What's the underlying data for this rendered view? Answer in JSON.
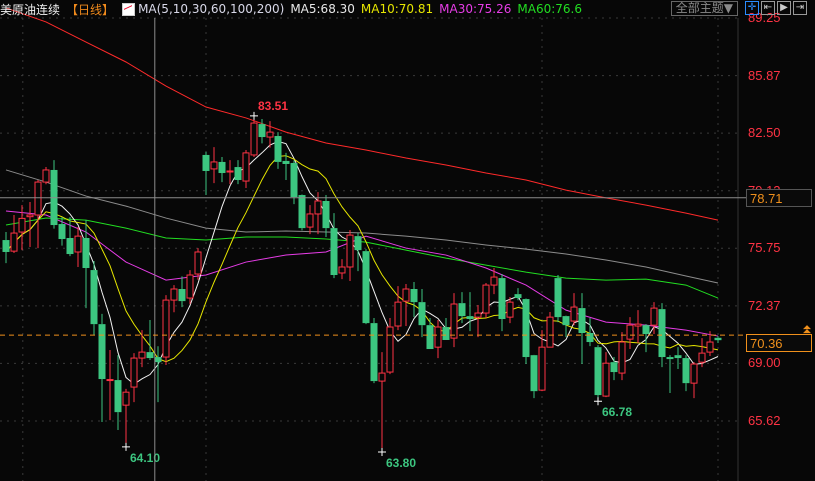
{
  "header": {
    "symbol": "美原油连续",
    "period_open": "【",
    "period": "日线",
    "period_close": "】",
    "ma_title": "MA(5,10,30,60,100,200)",
    "ma5": "MA5:68.30",
    "ma10": "MA10:70.81",
    "ma30": "MA30:75.26",
    "ma60": "MA60:76.6"
  },
  "toolbar": {
    "theme_label": "全部主题▼",
    "icons": [
      "crosshair-icon",
      "zoom-range-icon",
      "play-forward-icon",
      "move-right-icon"
    ]
  },
  "colors": {
    "up": "#ff3344",
    "down": "#3cc680",
    "ma5": "#f2f2f2",
    "ma10": "#e6e600",
    "ma30": "#e63ce6",
    "ma60": "#22dd22",
    "ma100": "#8c8c8c",
    "ma200": "#ff2a2a",
    "last": "#f0901c"
  },
  "chart_data": {
    "type": "candlestick",
    "title": "美原油连续 日线",
    "y_ticks": [
      "89.25",
      "85.87",
      "82.50",
      "79.12",
      "75.75",
      "72.37",
      "69.00",
      "65.62"
    ],
    "ylim": [
      65.62,
      89.25
    ],
    "grid": true,
    "ohlc": [
      [
        76.23,
        76.7,
        74.88,
        75.53
      ],
      [
        75.58,
        77.7,
        75.47,
        76.64
      ],
      [
        76.7,
        78.28,
        75.64,
        77.5
      ],
      [
        77.6,
        78.46,
        75.82,
        77.7
      ],
      [
        77.7,
        79.75,
        75.76,
        79.63
      ],
      [
        79.63,
        80.51,
        79.5,
        80.34
      ],
      [
        80.34,
        80.92,
        76.9,
        77.11
      ],
      [
        77.17,
        77.58,
        75.9,
        76.29
      ],
      [
        76.35,
        77.58,
        75.29,
        75.41
      ],
      [
        75.53,
        76.99,
        74.65,
        76.46
      ],
      [
        76.35,
        77.4,
        72.24,
        74.59
      ],
      [
        74.47,
        75.0,
        70.66,
        71.3
      ],
      [
        71.3,
        71.9,
        65.56,
        68.08
      ],
      [
        68.02,
        69.78,
        65.67,
        68.05
      ],
      [
        68.02,
        69.48,
        65.09,
        66.14
      ],
      [
        66.55,
        67.5,
        64.1,
        67.31
      ],
      [
        67.61,
        69.6,
        66.73,
        69.31
      ],
      [
        69.31,
        70.95,
        68.78,
        69.66
      ],
      [
        69.66,
        71.54,
        69.2,
        69.31
      ],
      [
        69.37,
        70.0,
        66.73,
        69.07
      ],
      [
        69.37,
        73.0,
        68.9,
        72.71
      ],
      [
        72.71,
        73.59,
        72.0,
        73.36
      ],
      [
        73.36,
        74.1,
        72.3,
        72.65
      ],
      [
        72.83,
        74.47,
        72.48,
        74.18
      ],
      [
        74.24,
        75.76,
        73.9,
        75.53
      ],
      [
        81.22,
        81.4,
        78.87,
        80.28
      ],
      [
        80.4,
        81.68,
        79.57,
        80.81
      ],
      [
        80.81,
        81.1,
        79.63,
        80.16
      ],
      [
        80.22,
        80.92,
        79.51,
        80.28
      ],
      [
        80.51,
        80.92,
        79.51,
        79.75
      ],
      [
        79.69,
        81.51,
        79.28,
        81.34
      ],
      [
        81.22,
        83.51,
        81.1,
        83.09
      ],
      [
        83.03,
        83.33,
        81.9,
        82.27
      ],
      [
        82.27,
        83.2,
        81.65,
        82.56
      ],
      [
        82.33,
        82.56,
        80.4,
        80.81
      ],
      [
        80.87,
        81.34,
        79.75,
        80.69
      ],
      [
        80.75,
        80.9,
        78.34,
        78.75
      ],
      [
        78.87,
        78.9,
        76.8,
        76.93
      ],
      [
        76.99,
        78.28,
        76.58,
        77.76
      ],
      [
        77.76,
        79.04,
        76.58,
        78.52
      ],
      [
        78.52,
        78.87,
        76.41,
        76.93
      ],
      [
        76.93,
        77.81,
        74.0,
        74.18
      ],
      [
        74.3,
        75.11,
        73.94,
        74.65
      ],
      [
        74.65,
        76.82,
        73.83,
        76.52
      ],
      [
        76.46,
        76.64,
        74.41,
        75.64
      ],
      [
        75.58,
        75.7,
        71.3,
        71.36
      ],
      [
        71.36,
        71.66,
        67.84,
        67.96
      ],
      [
        67.96,
        69.66,
        63.8,
        68.43
      ],
      [
        68.49,
        71.66,
        68.37,
        71.13
      ],
      [
        71.19,
        73.53,
        70.95,
        72.59
      ],
      [
        72.65,
        73.65,
        71.19,
        73.36
      ],
      [
        73.36,
        73.77,
        71.71,
        72.59
      ],
      [
        72.59,
        73.36,
        70.54,
        71.24
      ],
      [
        71.24,
        71.66,
        69.84,
        69.84
      ],
      [
        69.95,
        71.54,
        69.31,
        71.13
      ],
      [
        71.13,
        71.66,
        70.37,
        70.37
      ],
      [
        70.48,
        73.12,
        69.95,
        72.48
      ],
      [
        72.53,
        73.18,
        71.36,
        71.77
      ],
      [
        71.77,
        73.18,
        70.89,
        71.6
      ],
      [
        71.71,
        72.42,
        70.54,
        71.95
      ],
      [
        71.95,
        73.71,
        71.66,
        73.59
      ],
      [
        73.59,
        74.59,
        73.06,
        74.06
      ],
      [
        74.0,
        74.24,
        70.89,
        71.6
      ],
      [
        71.71,
        72.89,
        71.36,
        72.59
      ],
      [
        73.06,
        73.41,
        72.7,
        72.83
      ],
      [
        72.77,
        72.8,
        68.96,
        69.37
      ],
      [
        69.48,
        69.5,
        66.96,
        67.37
      ],
      [
        67.43,
        70.95,
        67.37,
        69.95
      ],
      [
        69.95,
        72.01,
        69.95,
        71.71
      ],
      [
        74.0,
        74.18,
        71.42,
        71.71
      ],
      [
        71.77,
        71.8,
        70.54,
        71.24
      ],
      [
        71.48,
        73.12,
        71.24,
        72.3
      ],
      [
        72.24,
        73.12,
        68.96,
        70.78
      ],
      [
        70.78,
        71.66,
        70.01,
        70.25
      ],
      [
        69.95,
        70.07,
        66.78,
        67.14
      ],
      [
        67.08,
        69.66,
        67.02,
        69.01
      ],
      [
        69.07,
        69.37,
        68.02,
        68.49
      ],
      [
        68.43,
        70.83,
        68.02,
        70.25
      ],
      [
        70.42,
        71.71,
        69.84,
        71.24
      ],
      [
        71.19,
        72.12,
        70.19,
        71.3
      ],
      [
        71.24,
        71.3,
        69.66,
        70.72
      ],
      [
        71.24,
        72.59,
        70.72,
        72.24
      ],
      [
        72.18,
        72.53,
        68.78,
        69.37
      ],
      [
        69.37,
        69.48,
        67.26,
        69.25
      ],
      [
        69.48,
        69.95,
        68.67,
        69.31
      ],
      [
        69.31,
        69.48,
        67.37,
        67.84
      ],
      [
        67.84,
        69.07,
        66.96,
        68.96
      ],
      [
        69.07,
        70.48,
        68.78,
        69.6
      ],
      [
        69.66,
        70.89,
        69.43,
        70.25
      ],
      [
        70.5,
        70.6,
        70.19,
        70.36
      ]
    ],
    "ma_sample_every": 5,
    "series": [
      {
        "name": "MA200",
        "values": [
          89.84,
          89.02,
          87.84,
          86.67,
          85.26,
          84.03,
          83.39,
          82.56,
          81.92,
          81.51,
          81.04,
          80.63,
          80.16,
          79.75,
          79.16,
          78.7,
          78.28,
          77.81,
          77.4
        ]
      },
      {
        "name": "MA100",
        "values": [
          80.34,
          79.63,
          78.81,
          78.22,
          77.52,
          76.93,
          76.7,
          76.76,
          76.7,
          76.64,
          76.46,
          76.23,
          75.94,
          75.7,
          75.41,
          75.06,
          74.65,
          74.12,
          73.71
        ]
      },
      {
        "name": "MA60",
        "values": [
          77.11,
          77.52,
          77.4,
          76.93,
          76.35,
          76.23,
          76.41,
          76.41,
          76.29,
          76.11,
          75.64,
          75.17,
          74.76,
          74.35,
          74.0,
          73.88,
          73.94,
          73.59,
          72.83
        ]
      },
      {
        "name": "MA30",
        "values": [
          77.93,
          77.7,
          76.7,
          74.94,
          73.88,
          74.18,
          74.94,
          75.35,
          75.53,
          76.46,
          75.76,
          75.35,
          74.59,
          73.59,
          72.12,
          71.42,
          71.24,
          70.95,
          70.6
        ]
      }
    ],
    "annotations": [
      {
        "text": "83.51",
        "index": 31,
        "price": 83.51,
        "color": "#ff3344",
        "pos": "above"
      },
      {
        "text": "64.10",
        "index": 15,
        "price": 64.1,
        "color": "#3cc680",
        "pos": "below"
      },
      {
        "text": "63.80",
        "index": 47,
        "price": 63.8,
        "color": "#3cc680",
        "pos": "below"
      },
      {
        "text": "66.78",
        "index": 74,
        "price": 66.78,
        "color": "#3cc680",
        "pos": "below"
      }
    ],
    "crosshair": {
      "index": 18.6,
      "price": 78.71,
      "label": "78.71"
    },
    "last_price": {
      "price": 70.36,
      "label": "70.36"
    }
  }
}
